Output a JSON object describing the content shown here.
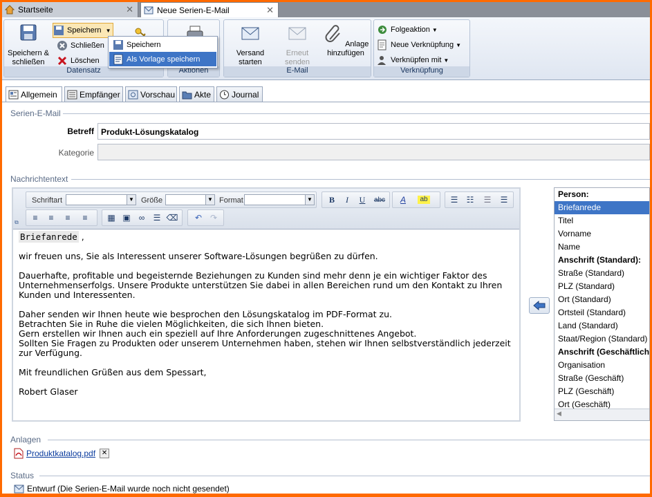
{
  "doc_tabs": [
    {
      "label": "Startseite"
    },
    {
      "label": "Neue Serien-E-Mail"
    }
  ],
  "ribbon": {
    "datensatz": {
      "title": "Datensatz",
      "save_close": "Speichern & schließen",
      "save": "Speichern",
      "close": "Schließen",
      "delete": "Löschen"
    },
    "save_menu": {
      "items": [
        "Speichern",
        "Als Vorlage speichern"
      ]
    },
    "aktionen": {
      "title": "Aktionen"
    },
    "email": {
      "title": "E-Mail",
      "send_start": "Versand starten",
      "resend": "Erneut senden",
      "attach": "Anlage hinzufügen"
    },
    "verknuepfung": {
      "title": "Verknüpfung",
      "followup": "Folgeaktion",
      "new_link": "Neue Verknüpfung",
      "link_with": "Verknüpfen mit"
    }
  },
  "section_tabs": [
    "Allgemein",
    "Empfänger",
    "Vorschau",
    "Akte",
    "Journal"
  ],
  "form": {
    "section_title": "Serien-E-Mail",
    "subject_label": "Betreff",
    "subject_value": "Produkt-Lösungskatalog",
    "category_label": "Kategorie",
    "category_value": "",
    "message_label": "Nachrichtentext"
  },
  "editor_toolbar": {
    "font_label": "Schriftart",
    "size_label": "Größe",
    "format_label": "Format"
  },
  "message": {
    "salutation_field": "Briefanrede",
    "salutation_suffix": " ,",
    "p1": "wir freuen uns, Sie als Interessent unserer Software-Lösungen begrüßen zu dürfen.",
    "p2": "Dauerhafte, profitable und begeisternde Beziehungen zu Kunden sind mehr denn je ein wichtiger Faktor des Unternehmenserfolgs. Unsere Produkte unterstützen Sie dabei in allen Bereichen rund um den Kontakt zu Ihren Kunden und Interessenten.",
    "p3_lines": [
      "Daher senden wir Ihnen heute wie besprochen den Lösungskatalog im PDF-Format zu.",
      "Betrachten Sie in Ruhe die vielen Möglichkeiten, die sich Ihnen bieten.",
      "Gern erstellen wir Ihnen auch ein speziell auf Ihre Anforderungen zugeschnittenes Angebot.",
      "Sollten Sie Fragen zu Produkten oder unserem Unternehmen haben, stehen wir Ihnen selbstverständlich jederzeit zur Verfügung."
    ],
    "closing": "Mit freundlichen Grüßen aus dem Spessart,",
    "signature": "Robert Glaser"
  },
  "field_list": [
    {
      "label": "Person:",
      "type": "header"
    },
    {
      "label": "Briefanrede",
      "type": "selected"
    },
    {
      "label": "Titel",
      "type": "item"
    },
    {
      "label": "Vorname",
      "type": "item"
    },
    {
      "label": "Name",
      "type": "item"
    },
    {
      "label": "Anschrift (Standard):",
      "type": "header"
    },
    {
      "label": "Straße (Standard)",
      "type": "item"
    },
    {
      "label": "PLZ (Standard)",
      "type": "item"
    },
    {
      "label": "Ort (Standard)",
      "type": "item"
    },
    {
      "label": "Ortsteil (Standard)",
      "type": "item"
    },
    {
      "label": "Land (Standard)",
      "type": "item"
    },
    {
      "label": "Staat/Region (Standard)",
      "type": "item"
    },
    {
      "label": "Anschrift (Geschäftlich):",
      "type": "header"
    },
    {
      "label": "Organisation",
      "type": "item"
    },
    {
      "label": "Straße (Geschäft)",
      "type": "item"
    },
    {
      "label": "PLZ (Geschäft)",
      "type": "item"
    },
    {
      "label": "Ort (Geschäft)",
      "type": "item"
    }
  ],
  "attachments": {
    "label": "Anlagen",
    "file": "Produktkatalog.pdf"
  },
  "status": {
    "label": "Status",
    "value": "Entwurf (Die Serien-E-Mail wurde noch nicht gesendet)"
  },
  "colors": {
    "accent": "#3e75c6",
    "frame": "#ff6a00"
  }
}
